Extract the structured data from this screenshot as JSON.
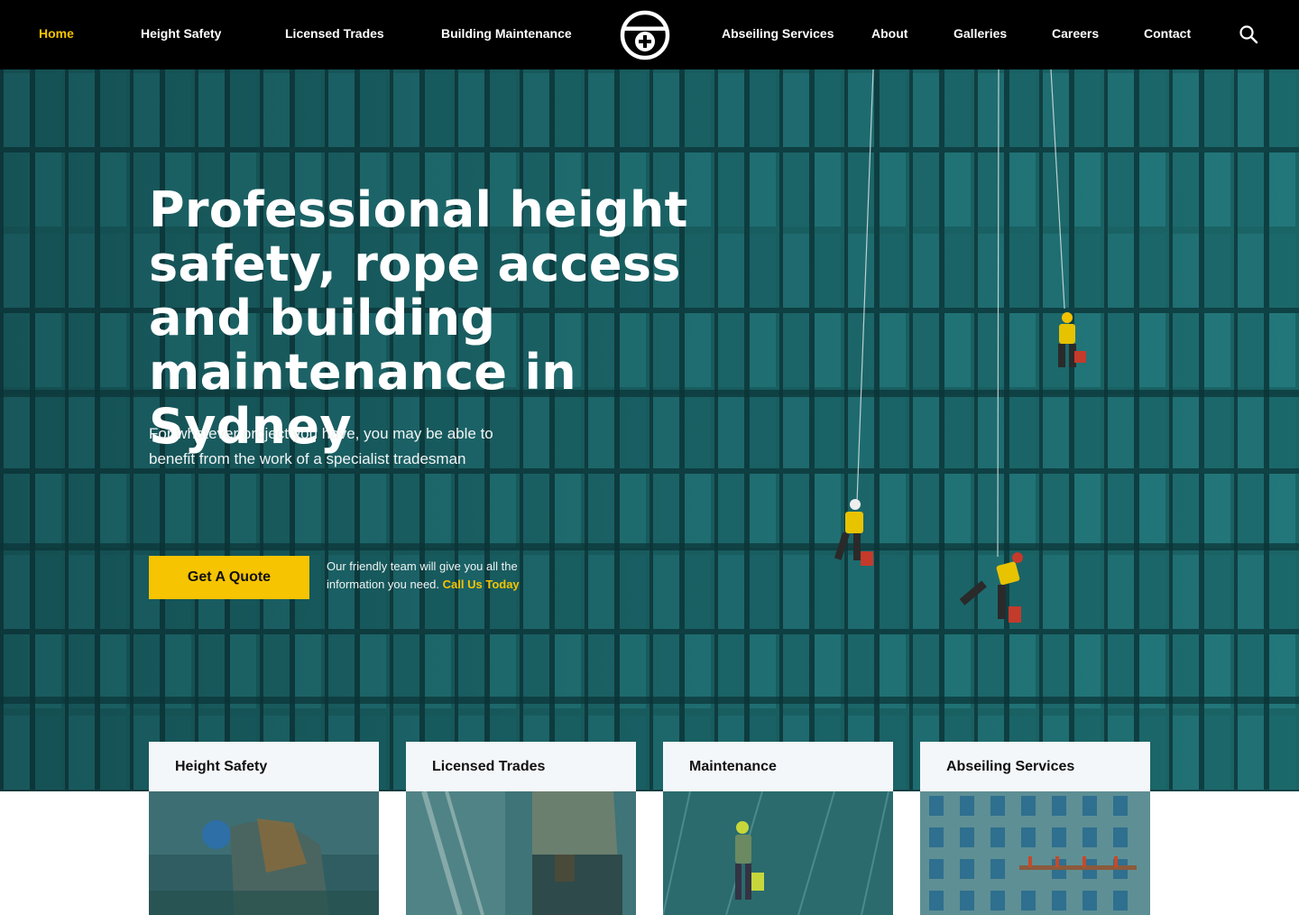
{
  "nav": {
    "left_items": [
      {
        "label": "Home",
        "active": true
      },
      {
        "label": "Height Safety",
        "active": false
      },
      {
        "label": "Licensed Trades",
        "active": false
      },
      {
        "label": "Building Maintenance",
        "active": false
      }
    ],
    "right_items": [
      {
        "label": "Abseiling Services"
      },
      {
        "label": "About"
      },
      {
        "label": "Galleries"
      },
      {
        "label": "Careers"
      },
      {
        "label": "Contact"
      }
    ],
    "logo_icon": "shield-cross-logo-icon",
    "search_icon": "search-icon"
  },
  "hero": {
    "title": "Professional height safety, rope access and building maintenance in Sydney",
    "lead": "For whatever project you have, you may be able to benefit from the work of a specialist tradesman",
    "cta_button": "Get A Quote",
    "cta_note": "Our friendly team will give you all the information you need.",
    "cta_link": "Call Us Today"
  },
  "cards": [
    {
      "title": "Height Safety"
    },
    {
      "title": "Licensed Trades"
    },
    {
      "title": "Maintenance"
    },
    {
      "title": "Abseiling Services"
    }
  ],
  "colors": {
    "accent": "#f6c400",
    "nav_bg": "#000000",
    "hero_teal": "#17595c",
    "card_title_bg": "#f4f7fa"
  }
}
